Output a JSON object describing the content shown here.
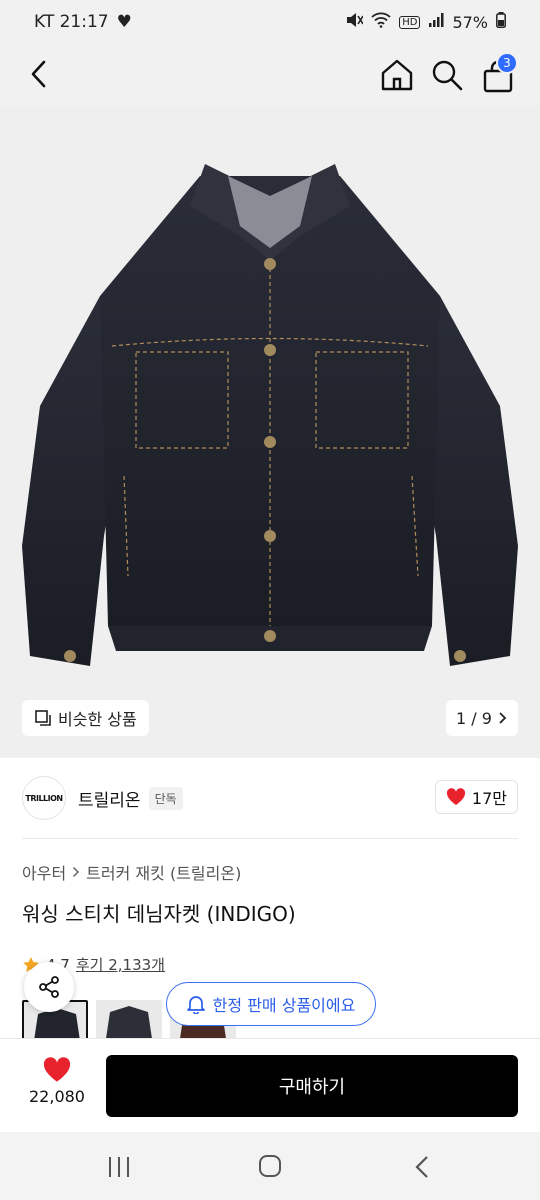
{
  "status": {
    "carrier_time": "KT 21:17",
    "battery": "57%"
  },
  "header": {
    "cart_count": "3",
    "icons": [
      "back-icon",
      "home-icon",
      "search-icon",
      "cart-icon"
    ]
  },
  "gallery": {
    "similar_label": "비슷한 상품",
    "page_counter": "1 / 9"
  },
  "brand": {
    "logo_text": "TRILLION",
    "name": "트릴리온",
    "tag": "단독",
    "likes": "17만"
  },
  "product": {
    "breadcrumb_1": "아우터",
    "breadcrumb_2": "트러커 재킷 (트릴리온)",
    "title": "워싱 스티치 데님자켓 (INDIGO)",
    "rating": "4.7",
    "review_label": "후기 2,133개",
    "limited_notice": "한정 판매 상품이에요"
  },
  "bottom": {
    "like_count": "22,080",
    "buy_label": "구매하기"
  },
  "colors": {
    "accent_blue": "#2f6bff",
    "heart_red": "#e8232e",
    "buy_black": "#000000"
  }
}
